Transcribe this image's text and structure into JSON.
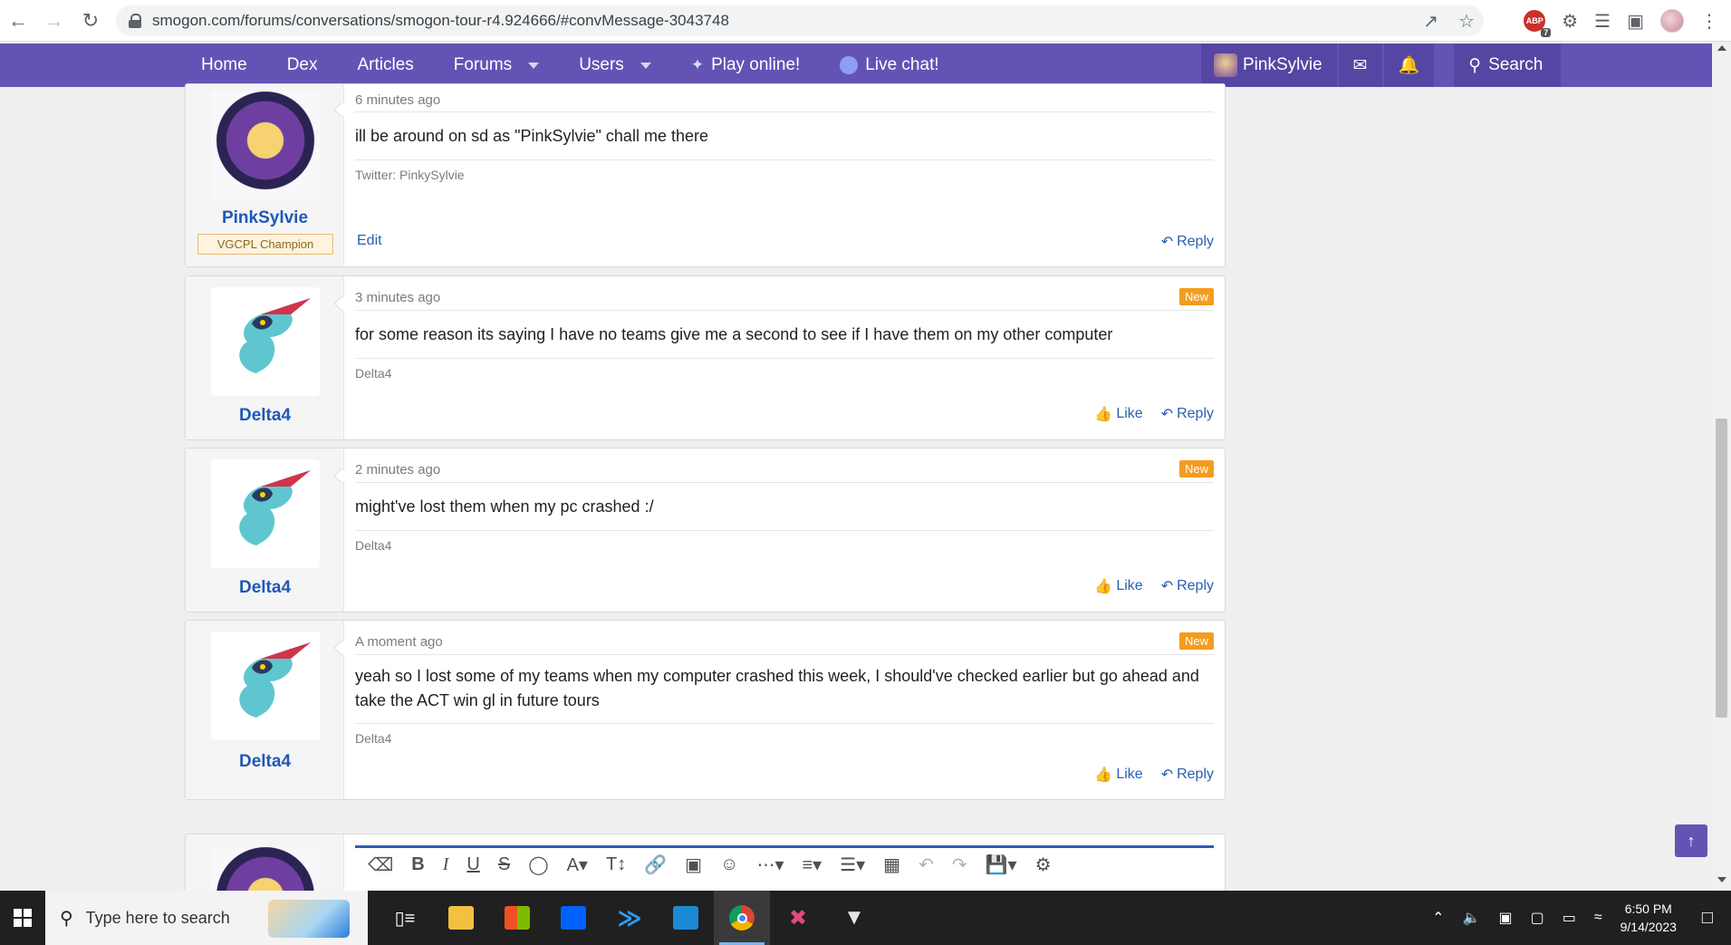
{
  "browser": {
    "url": "smogon.com/forums/conversations/smogon-tour-r4.924666/#convMessage-3043748",
    "ext_badge": "ABP",
    "ext_badge_count": "7"
  },
  "nav": {
    "items": [
      "Home",
      "Dex",
      "Articles",
      "Forums",
      "Users"
    ],
    "play": "Play online!",
    "chat": "Live chat!",
    "username": "PinkSylvie",
    "search": "Search"
  },
  "messages": [
    {
      "time": "6 minutes ago",
      "body": "ill be around on sd as \"PinkSylvie\" chall me there",
      "signature": "Twitter: PinkySylvie",
      "user": "PinkSylvie",
      "banner": "VGCPL Champion",
      "edit": "Edit",
      "reply": "Reply"
    },
    {
      "time": "3 minutes ago",
      "new": "New",
      "body": "for some reason its saying I have no teams give me a second to see if I have them on my other computer",
      "signature": "Delta4",
      "user": "Delta4",
      "like": "Like",
      "reply": "Reply"
    },
    {
      "time": "2 minutes ago",
      "new": "New",
      "body": "might've lost them when my pc crashed :/",
      "signature": "Delta4",
      "user": "Delta4",
      "like": "Like",
      "reply": "Reply"
    },
    {
      "time": "A moment ago",
      "new": "New",
      "body": "yeah so I lost some of my teams when my computer crashed this week, I should've checked earlier but go ahead and take the ACT win gl in future tours",
      "signature": "Delta4",
      "user": "Delta4",
      "like": "Like",
      "reply": "Reply"
    }
  ],
  "taskbar": {
    "search_placeholder": "Type here to search",
    "time": "6:50 PM",
    "date": "9/14/2023"
  },
  "colors": {
    "nav_bg": "#6453b5",
    "link": "#1f58b8",
    "new_badge": "#f39c1f"
  }
}
